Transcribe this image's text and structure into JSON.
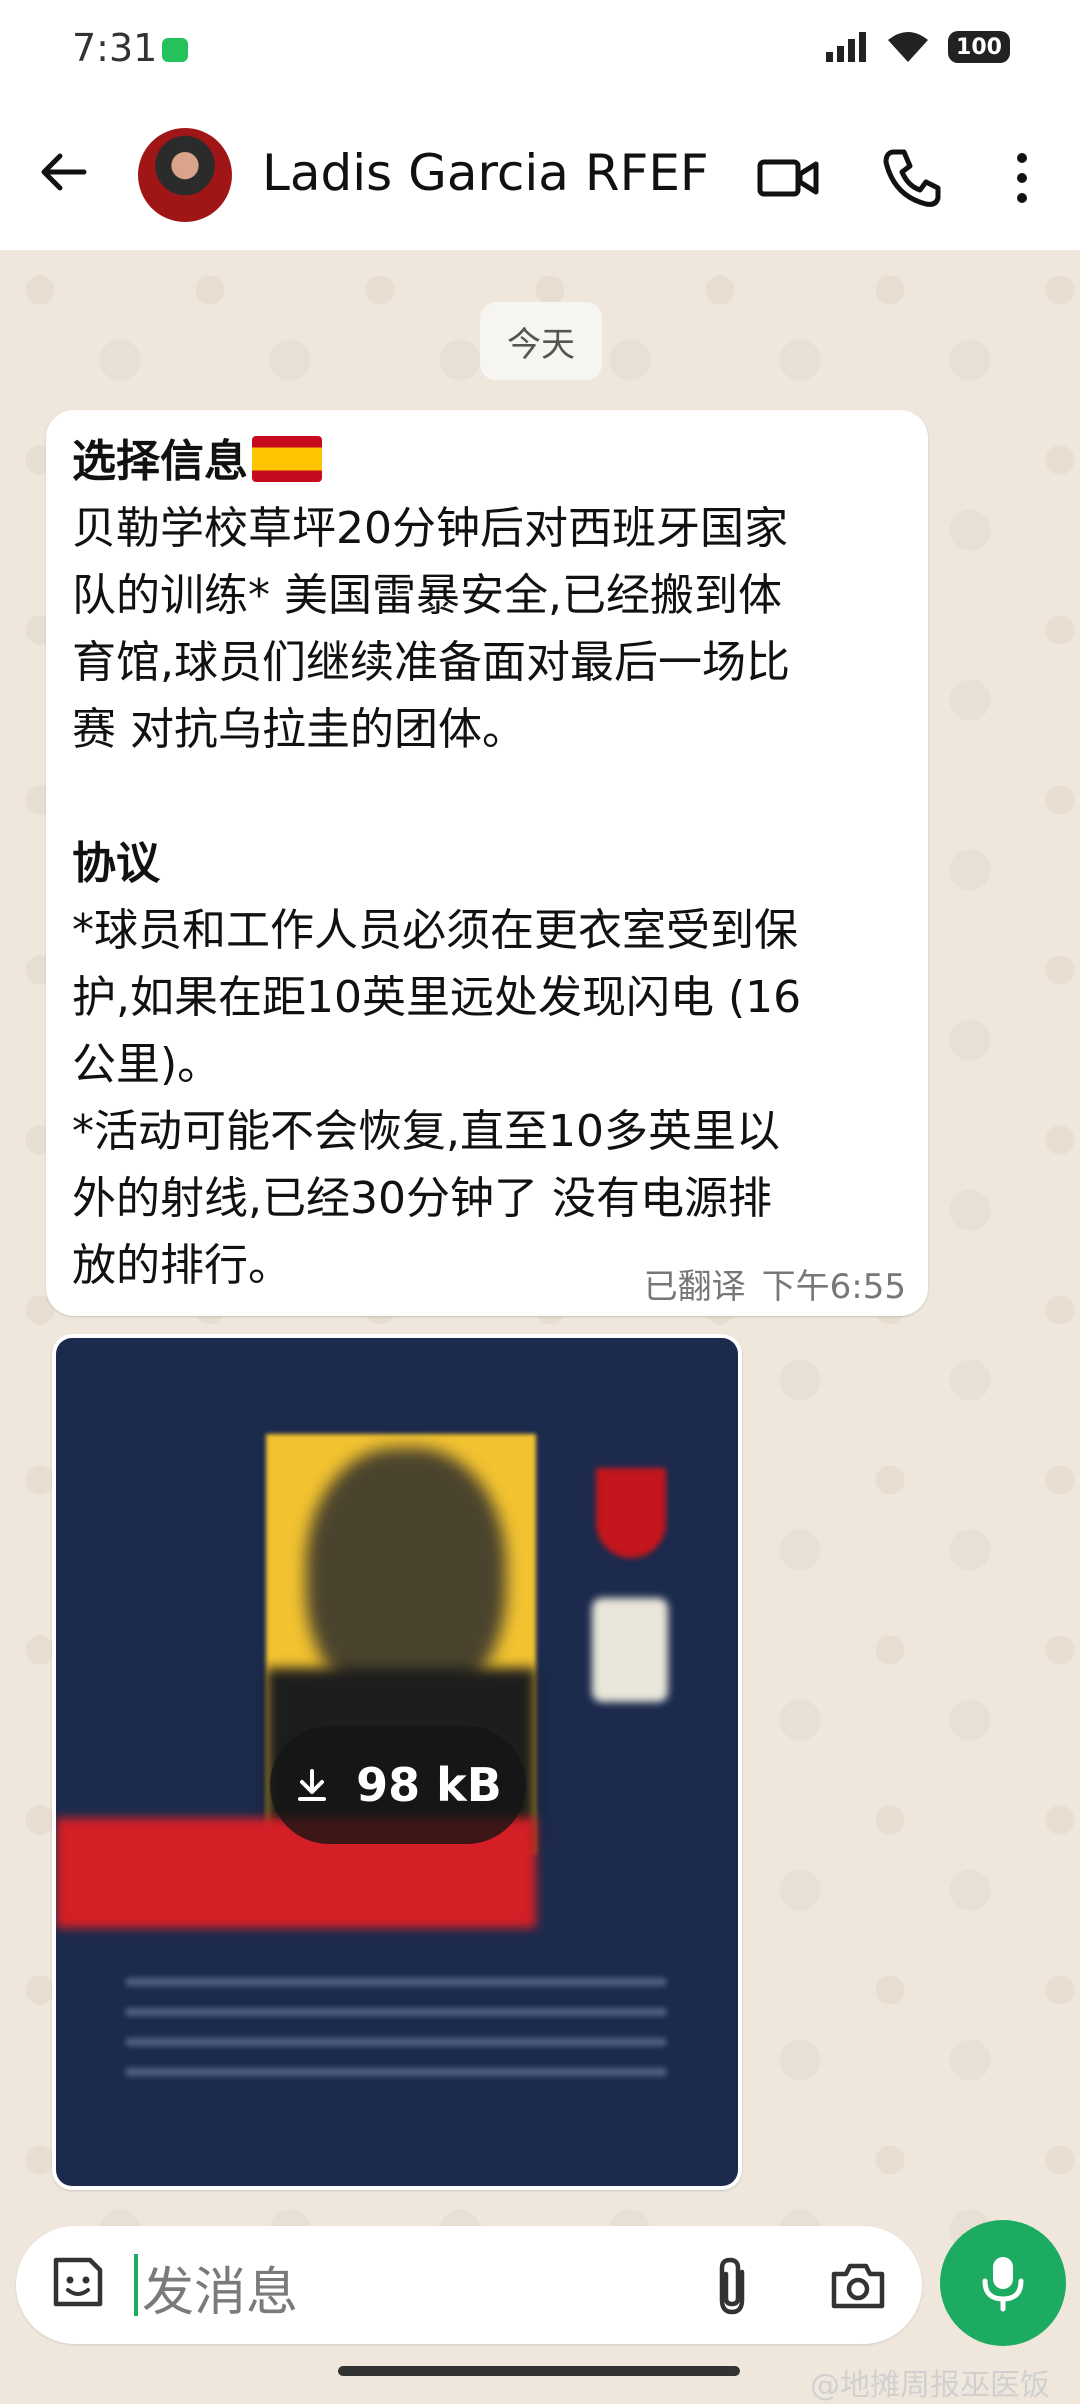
{
  "status_bar": {
    "time": "7:31",
    "battery": "100"
  },
  "header": {
    "contact_name": "Ladis Garcia RFEF"
  },
  "chat": {
    "date_chip": "今天",
    "message": {
      "title": "选择信息",
      "para1": "贝勒学校草坪20分钟后对西班牙国家\n队的训练* 美国雷暴安全,已经搬到体\n育馆,球员们继续准备面对最后一场比\n赛 对抗乌拉圭的团体。",
      "protocol_title": "协议",
      "para2": "*球员和工作人员必须在更衣室受到保\n护,如果在距10英里远处发现闪电 (16\n公里)。\n*活动可能不会恢复,直至10多英里以\n外的射线,已经30分钟了 没有电源排\n放的排行。",
      "translated_label": "已翻译",
      "time": "下午6:55"
    },
    "image_message": {
      "size_label": "98 kB"
    }
  },
  "input": {
    "placeholder": "发消息"
  },
  "watermark": "@地摊周报巫医饭",
  "colors": {
    "accent": "#1daa61",
    "chat_bg": "#efe7dc"
  }
}
